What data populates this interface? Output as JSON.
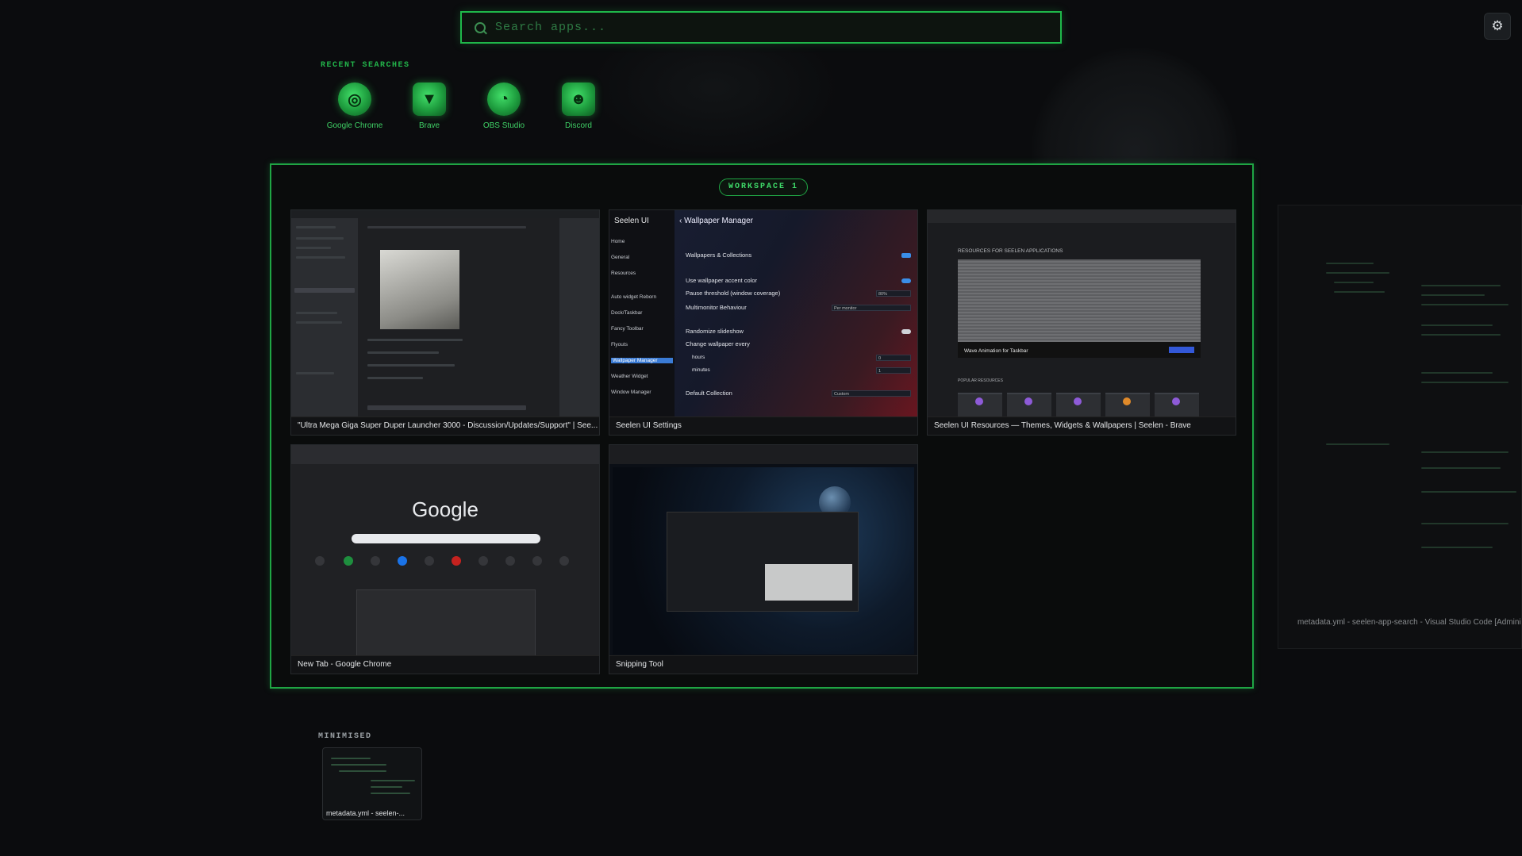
{
  "search": {
    "placeholder": "Search apps..."
  },
  "settings_icon": "gear-icon",
  "recent": {
    "label": "RECENT SEARCHES",
    "items": [
      {
        "name": "Google Chrome",
        "icon": "chrome-icon"
      },
      {
        "name": "Brave",
        "icon": "brave-icon"
      },
      {
        "name": "OBS Studio",
        "icon": "obs-icon"
      },
      {
        "name": "Discord",
        "icon": "discord-icon"
      }
    ]
  },
  "workspace": {
    "title": "WORKSPACE 1",
    "windows": [
      {
        "caption": "\"Ultra Mega Giga Super Duper Launcher 3000 - Discussion/Updates/Support\" | See..."
      },
      {
        "caption": "Seelen UI Settings",
        "content": {
          "app": "Seelen UI",
          "page": "Wallpaper Manager",
          "nav": [
            "Home",
            "General",
            "Resources",
            "Auto widget Reborn",
            "Dock/Taskbar",
            "Fancy Toolbar",
            "Flyouts",
            "Wallpaper Manager",
            "Weather Widget",
            "Window Manager"
          ],
          "active_nav": "Wallpaper Manager",
          "rows": [
            "Wallpapers & Collections",
            "Use wallpaper accent color",
            "Pause threshold (window coverage)",
            "Multimonitor Behaviour",
            "Randomize slideshow",
            "Change wallpaper every",
            "hours",
            "minutes",
            "Default Collection"
          ],
          "values": {
            "pause": "80%",
            "multimonitor": "Per monitor",
            "hours": "0",
            "minutes": "1",
            "collection": "Custom"
          }
        }
      },
      {
        "caption": "Seelen UI Resources — Themes, Widgets & Wallpapers | Seelen - Brave",
        "content": {
          "heading": "RESOURCES FOR SEELEN APPLICATIONS",
          "banner": "Wave Animation for Taskbar",
          "popular": "POPULAR RESOURCES"
        }
      },
      {
        "caption": "New Tab - Google Chrome",
        "content": {
          "logo": "Google"
        }
      },
      {
        "caption": "Snipping Tool"
      }
    ]
  },
  "side_window": {
    "caption": "metadata.yml - seelen-app-search - Visual Studio Code [Administr"
  },
  "minimised": {
    "label": "MINIMISED",
    "items": [
      {
        "caption": "metadata.yml - seelen-..."
      }
    ]
  }
}
